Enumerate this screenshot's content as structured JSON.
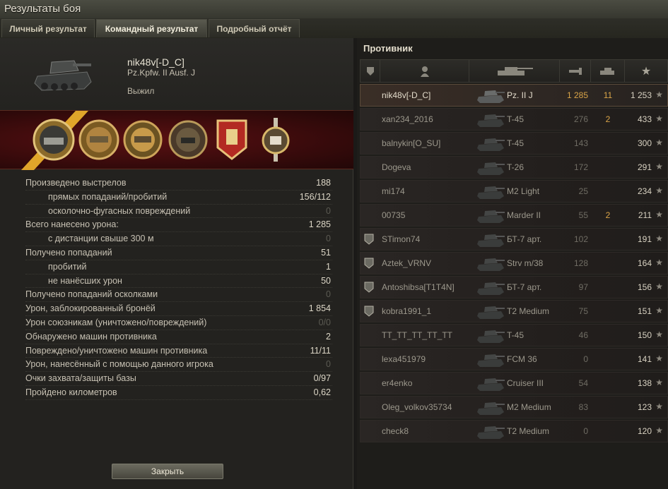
{
  "window": {
    "title": "Результаты боя"
  },
  "tabs": [
    {
      "label": "Личный результат",
      "active": false
    },
    {
      "label": "Командный результат",
      "active": true
    },
    {
      "label": "Подробный отчёт",
      "active": false
    }
  ],
  "player": {
    "name": "nik48v[-D_C]",
    "tank": "Pz.Kpfw. II Ausf. J",
    "status": "Выжил"
  },
  "medals": [
    "ace-tanker-medal",
    "class-1-medal",
    "class-2-medal",
    "sharpshooter-medal",
    "defender-medal",
    "top-gun-medal"
  ],
  "stats": [
    {
      "label": "Произведено выстрелов",
      "value": "188",
      "sub": false,
      "dim": false
    },
    {
      "label": "прямых попаданий/пробитий",
      "value": "156/112",
      "sub": true,
      "dim": false
    },
    {
      "label": "осколочно-фугасных повреждений",
      "value": "0",
      "sub": true,
      "dim": true
    },
    {
      "label": "Всего нанесено урона:",
      "value": "1 285",
      "sub": false,
      "dim": false
    },
    {
      "label": "с дистанции свыше 300 м",
      "value": "0",
      "sub": true,
      "dim": true
    },
    {
      "label": "Получено попаданий",
      "value": "51",
      "sub": false,
      "dim": false
    },
    {
      "label": "пробитий",
      "value": "1",
      "sub": true,
      "dim": false
    },
    {
      "label": "не нанёсших урон",
      "value": "50",
      "sub": true,
      "dim": false
    },
    {
      "label": "Получено попаданий осколками",
      "value": "0",
      "sub": false,
      "dim": true
    },
    {
      "label": "Урон, заблокированный бронёй",
      "value": "1 854",
      "sub": false,
      "dim": false
    },
    {
      "label": "Урон союзникам (уничтожено/повреждений)",
      "value": "0/0",
      "sub": false,
      "dim": true
    },
    {
      "label": "Обнаружено машин противника",
      "value": "2",
      "sub": false,
      "dim": false
    },
    {
      "label": "Повреждено/уничтожено машин противника",
      "value": "11/11",
      "sub": false,
      "dim": false
    },
    {
      "label": "Урон, нанесённый с помощью данного игрока",
      "value": "0",
      "sub": false,
      "dim": true
    },
    {
      "label": "Очки захвата/защиты базы",
      "value": "0/97",
      "sub": false,
      "dim": false
    },
    {
      "label": "Пройдено километров",
      "value": "0,62",
      "sub": false,
      "dim": false
    }
  ],
  "close_label": "Закрыть",
  "enemy": {
    "title": "Противник",
    "columns": [
      "rank-icon",
      "player-icon",
      "tank-icon",
      "damage-icon",
      "kills-icon",
      "star-icon"
    ],
    "rows": [
      {
        "name": "nik48v[-D_C]",
        "tank": "Pz. II J",
        "damage": "1 285",
        "kills": "11",
        "xp": "1 253",
        "rank": "",
        "self": true
      },
      {
        "name": "xan234_2016",
        "tank": "T-45",
        "damage": "276",
        "kills": "2",
        "xp": "433",
        "rank": "",
        "self": false
      },
      {
        "name": "balnykin[O_SU]",
        "tank": "T-45",
        "damage": "143",
        "kills": "",
        "xp": "300",
        "rank": "",
        "self": false
      },
      {
        "name": "Dogeva",
        "tank": "T-26",
        "damage": "172",
        "kills": "",
        "xp": "291",
        "rank": "",
        "self": false
      },
      {
        "name": "mi174",
        "tank": "M2 Light",
        "damage": "25",
        "kills": "",
        "xp": "234",
        "rank": "",
        "self": false
      },
      {
        "name": "00735",
        "tank": "Marder II",
        "damage": "55",
        "kills": "2",
        "xp": "211",
        "rank": "",
        "self": false
      },
      {
        "name": "STimon74",
        "tank": "БТ-7 арт.",
        "damage": "102",
        "kills": "",
        "xp": "191",
        "rank": "2",
        "self": false
      },
      {
        "name": "Aztek_VRNV",
        "tank": "Strv m/38",
        "damage": "128",
        "kills": "",
        "xp": "164",
        "rank": "1",
        "self": false
      },
      {
        "name": "Antoshibsa[T1T4N]",
        "tank": "БТ-7 арт.",
        "damage": "97",
        "kills": "",
        "xp": "156",
        "rank": "2",
        "self": false
      },
      {
        "name": "kobra1991_1",
        "tank": "T2 Medium",
        "damage": "75",
        "kills": "",
        "xp": "151",
        "rank": "1",
        "self": false
      },
      {
        "name": "TT_TT_TT_TT_TT",
        "tank": "T-45",
        "damage": "46",
        "kills": "",
        "xp": "150",
        "rank": "",
        "self": false
      },
      {
        "name": "lexa451979",
        "tank": "FCM 36",
        "damage": "0",
        "kills": "",
        "xp": "141",
        "rank": "",
        "self": false
      },
      {
        "name": "er4enko",
        "tank": "Cruiser III",
        "damage": "54",
        "kills": "",
        "xp": "138",
        "rank": "",
        "self": false
      },
      {
        "name": "Oleg_volkov35734",
        "tank": "M2 Medium",
        "damage": "83",
        "kills": "",
        "xp": "123",
        "rank": "",
        "self": false
      },
      {
        "name": "check8",
        "tank": "T2 Medium",
        "damage": "0",
        "kills": "",
        "xp": "120",
        "rank": "",
        "self": false
      }
    ]
  },
  "colors": {
    "accent": "#d9a448",
    "medal_bg": "#4a0e10",
    "ribbon": "#e0a52a"
  }
}
